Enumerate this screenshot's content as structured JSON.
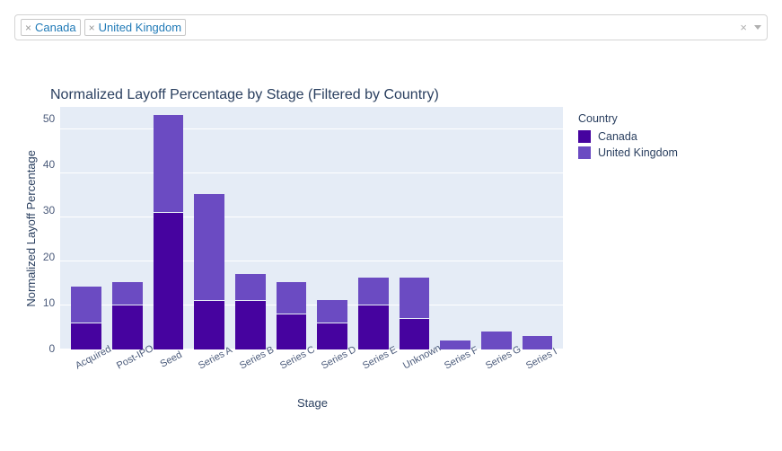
{
  "filter": {
    "countries": [
      "Canada",
      "United Kingdom"
    ]
  },
  "chart_title": "Normalized Layoff Percentage by Stage (Filtered by Country)",
  "xlabel": "Stage",
  "ylabel": "Normalized Layoff Percentage",
  "legend_title": "Country",
  "legend": {
    "canada_label": "Canada",
    "uk_label": "United Kingdom"
  },
  "yticks": [
    "50",
    "40",
    "30",
    "20",
    "10",
    "0"
  ],
  "chart_data": {
    "type": "bar",
    "stacked": true,
    "categories": [
      "Acquired",
      "Post-IPO",
      "Seed",
      "Series A",
      "Series B",
      "Series C",
      "Series D",
      "Series E",
      "Unknown",
      "Series F",
      "Series G",
      "Series I"
    ],
    "series": [
      {
        "name": "Canada",
        "values": [
          6,
          10,
          31,
          11,
          11,
          8,
          6,
          10,
          7,
          0,
          0,
          0
        ]
      },
      {
        "name": "United Kingdom",
        "values": [
          8,
          5,
          22,
          24,
          6,
          7,
          5,
          6,
          9,
          2,
          4,
          3
        ]
      }
    ],
    "title": "Normalized Layoff Percentage by Stage (Filtered by Country)",
    "xlabel": "Stage",
    "ylabel": "Normalized Layoff Percentage",
    "ylim": [
      0,
      55
    ],
    "colors": {
      "Canada": "#46039f",
      "United Kingdom": "#6b4bc2"
    }
  }
}
